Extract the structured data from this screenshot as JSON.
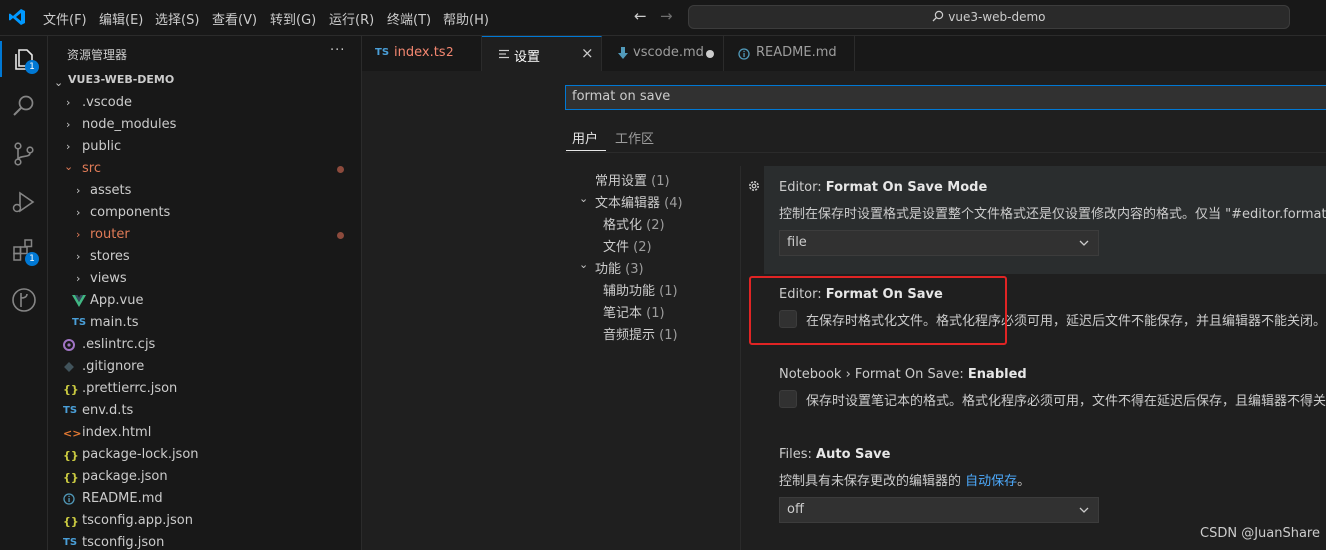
{
  "titlebar": {
    "menus": [
      "文件(F)",
      "编辑(E)",
      "选择(S)",
      "查看(V)",
      "转到(G)",
      "运行(R)",
      "终端(T)",
      "帮助(H)"
    ],
    "search_text": "vue3-web-demo",
    "back": "←",
    "forward": "→"
  },
  "activitybar": {
    "explorer_badge": "1",
    "extensions_badge": "1"
  },
  "explorer": {
    "title": "资源管理器",
    "more": "···",
    "project": "VUE3-WEB-DEMO",
    "items": [
      {
        "label": ".vscode",
        "icon": "folder-closed"
      },
      {
        "label": "node_modules",
        "icon": "folder-closed"
      },
      {
        "label": "public",
        "icon": "folder-closed"
      },
      {
        "label": "src",
        "icon": "folder-open"
      },
      {
        "label": "assets",
        "icon": "folder-closed"
      },
      {
        "label": "components",
        "icon": "folder-closed"
      },
      {
        "label": "router",
        "icon": "folder-closed"
      },
      {
        "label": "stores",
        "icon": "folder-closed"
      },
      {
        "label": "views",
        "icon": "folder-closed"
      },
      {
        "label": "App.vue",
        "icon": "vue-icon"
      },
      {
        "label": "main.ts",
        "icon": "ts-icon"
      },
      {
        "label": ".eslintrc.cjs",
        "icon": "eslint-icon"
      },
      {
        "label": ".gitignore",
        "icon": "git-icon"
      },
      {
        "label": ".prettierrc.json",
        "icon": "json-icon"
      },
      {
        "label": "env.d.ts",
        "icon": "ts-icon"
      },
      {
        "label": "index.html",
        "icon": "html-icon"
      },
      {
        "label": "package-lock.json",
        "icon": "json-icon"
      },
      {
        "label": "package.json",
        "icon": "json-icon"
      },
      {
        "label": "README.md",
        "icon": "info-icon"
      },
      {
        "label": "tsconfig.app.json",
        "icon": "json-icon"
      },
      {
        "label": "tsconfig.json",
        "icon": "ts-icon"
      }
    ],
    "icon_text": {
      "ts": "TS",
      "json": "{}",
      "html": "<>",
      "vue": "V"
    }
  },
  "tabs": [
    {
      "label": "index.ts",
      "count": "2",
      "icon": "ts-icon"
    },
    {
      "label": "设置",
      "icon": "settings-icon",
      "active": true,
      "close": "×"
    },
    {
      "label": "vscode.md",
      "icon": "markdown-icon"
    },
    {
      "label": "README.md",
      "icon": "info-icon"
    }
  ],
  "settings": {
    "search_value": "format on save",
    "scope_tabs": [
      "用户",
      "工作区"
    ],
    "toc": [
      {
        "label": "常用设置",
        "count": "(1)"
      },
      {
        "label": "文本编辑器",
        "count": "(4)"
      },
      {
        "label": "格式化",
        "count": "(2)"
      },
      {
        "label": "文件",
        "count": "(2)"
      },
      {
        "label": "功能",
        "count": "(3)"
      },
      {
        "label": "辅助功能",
        "count": "(1)"
      },
      {
        "label": "笔记本",
        "count": "(1)"
      },
      {
        "label": "音频提示",
        "count": "(1)"
      }
    ],
    "items": [
      {
        "prefix": "Editor: ",
        "name": "Format On Save Mode",
        "desc": "控制在保存时设置格式是设置整个文件格式还是仅设置修改内容的格式。仅当 \"#editor.formatOn",
        "value": "file"
      },
      {
        "prefix": "Editor: ",
        "name": "Format On Save",
        "desc": "在保存时格式化文件。格式化程序必须可用，延迟后文件不能保存，并且编辑器不能关闭。"
      },
      {
        "prefix": "Notebook › Format On Save: ",
        "name": "Enabled",
        "desc": "保存时设置笔记本的格式。格式化程序必须可用，文件不得在延迟后保存，且编辑器不得关"
      },
      {
        "prefix": "Files: ",
        "name": "Auto Save",
        "desc_pre": "控制具有未保存更改的编辑器的 ",
        "desc_link": "自动保存",
        "desc_post": "。",
        "value": "off"
      }
    ]
  },
  "watermark": "CSDN @JuanShare",
  "colors": {
    "accent": "#0078d4",
    "modified": "#e07b57",
    "highlight_box": "#e02424"
  }
}
